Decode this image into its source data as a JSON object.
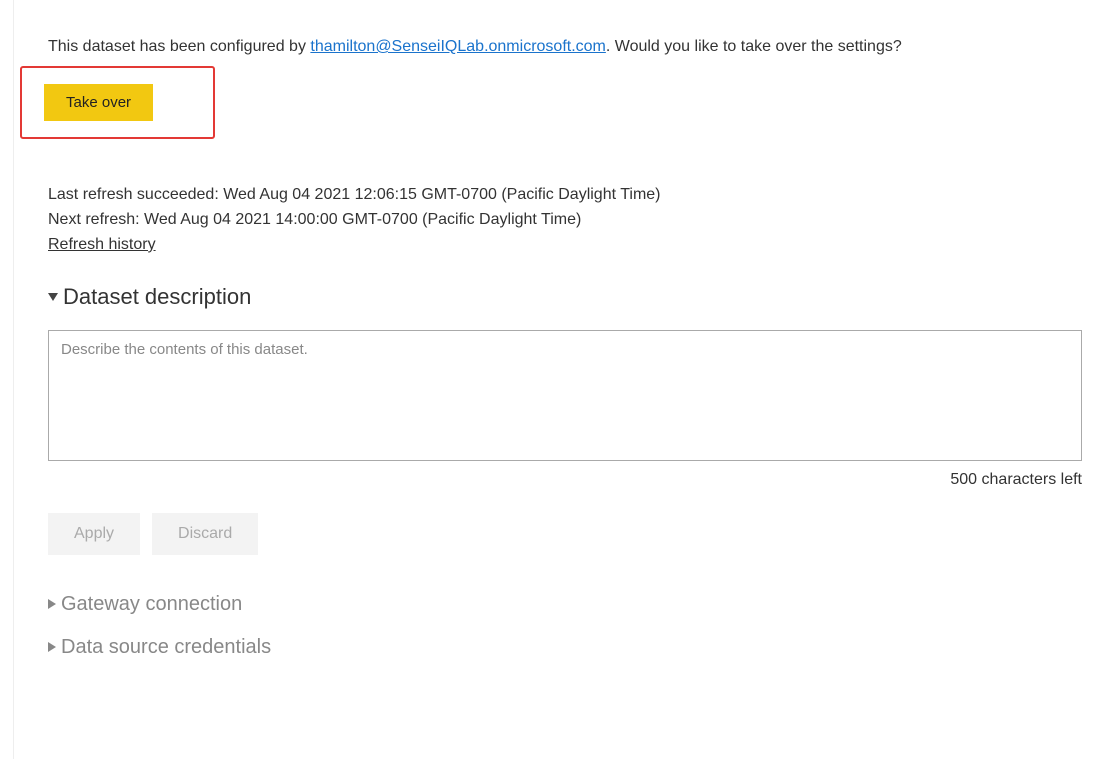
{
  "intro": {
    "prefix": "This dataset has been configured by ",
    "email": "thamilton@SenseiIQLab.onmicrosoft.com",
    "suffix": ". Would you like to take over the settings?"
  },
  "takeOverButton": "Take over",
  "refresh": {
    "lastLabel": "Last refresh succeeded: ",
    "lastValue": "Wed Aug 04 2021 12:06:15 GMT-0700 (Pacific Daylight Time)",
    "nextLabel": "Next refresh: ",
    "nextValue": "Wed Aug 04 2021 14:00:00 GMT-0700 (Pacific Daylight Time)",
    "historyLink": "Refresh history"
  },
  "sections": {
    "description": {
      "title": "Dataset description",
      "placeholder": "Describe the contents of this dataset.",
      "value": "",
      "charCount": "500 characters left"
    },
    "gateway": {
      "title": "Gateway connection"
    },
    "credentials": {
      "title": "Data source credentials"
    }
  },
  "buttons": {
    "apply": "Apply",
    "discard": "Discard"
  }
}
